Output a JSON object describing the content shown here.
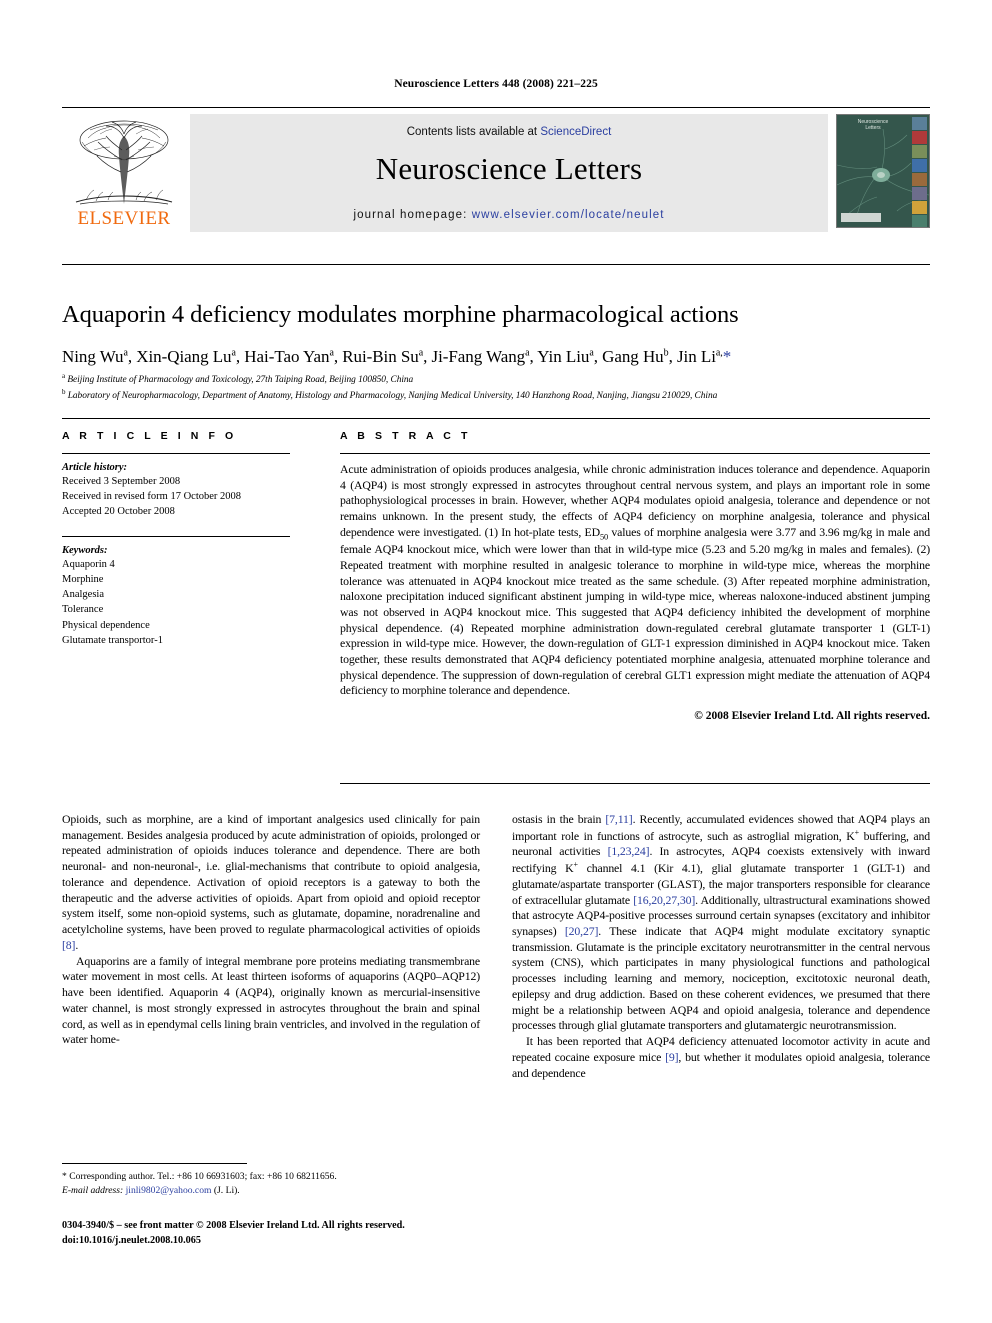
{
  "running_head": "Neuroscience Letters 448 (2008) 221–225",
  "masthead": {
    "publisher_logo_text": "ELSEVIER",
    "contents_prefix": "Contents lists available at ",
    "contents_link": "ScienceDirect",
    "journal_title": "Neuroscience Letters",
    "homepage_prefix": "journal homepage: ",
    "homepage_url": "www.elsevier.com/locate/neulet",
    "cover_title": "Neuroscience Letters"
  },
  "article": {
    "title": "Aquaporin 4 deficiency modulates morphine pharmacological actions",
    "authors_html": "Ning Wu<sup>a</sup>, Xin-Qiang Lu<sup>a</sup>, Hai-Tao Yan<sup>a</sup>, Rui-Bin Su<sup>a</sup>, Ji-Fang Wang<sup>a</sup>, Yin Liu<sup>a</sup>, Gang Hu<sup>b</sup>, Jin Li<sup>a,</sup><span class=\"star\">*</span>",
    "affiliation_a": "Beijing Institute of Pharmacology and Toxicology, 27th Taiping Road, Beijing 100850, China",
    "affiliation_b": "Laboratory of Neuropharmacology, Department of Anatomy, Histology and Pharmacology, Nanjing Medical University, 140 Hanzhong Road, Nanjing, Jiangsu 210029, China"
  },
  "article_info": {
    "heading": "A R T I C L E   I N F O",
    "history_label": "Article history:",
    "history": [
      "Received 3 September 2008",
      "Received in revised form 17 October 2008",
      "Accepted 20 October 2008"
    ],
    "keywords_label": "Keywords:",
    "keywords": [
      "Aquaporin 4",
      "Morphine",
      "Analgesia",
      "Tolerance",
      "Physical dependence",
      "Glutamate transportor-1"
    ]
  },
  "abstract": {
    "heading": "A B S T R A C T",
    "text_html": "Acute administration of opioids produces analgesia, while chronic administration induces tolerance and dependence. Aquaporin 4 (AQP4) is most strongly expressed in astrocytes throughout central nervous system, and plays an important role in some pathophysiological processes in brain. However, whether AQP4 modulates opioid analgesia, tolerance and dependence or not remains unknown. In the present study, the effects of AQP4 deficiency on morphine analgesia, tolerance and physical dependence were investigated. (1) In hot-plate tests, ED<sub>50</sub> values of morphine analgesia were 3.77 and 3.96 mg/kg in male and female AQP4 knockout mice, which were lower than that in wild-type mice (5.23 and 5.20 mg/kg in males and females). (2) Repeated treatment with morphine resulted in analgesic tolerance to morphine in wild-type mice, whereas the morphine tolerance was attenuated in AQP4 knockout mice treated as the same schedule. (3) After repeated morphine administration, naloxone precipitation induced significant abstinent jumping in wild-type mice, whereas naloxone-induced abstinent jumping was not observed in AQP4 knockout mice. This suggested that AQP4 deficiency inhibited the development of morphine physical dependence. (4) Repeated morphine administration down-regulated cerebral glutamate transporter 1 (GLT-1) expression in wild-type mice. However, the down-regulation of GLT-1 expression diminished in AQP4 knockout mice. Taken together, these results demonstrated that AQP4 deficiency potentiated morphine analgesia, attenuated morphine tolerance and physical dependence. The suppression of down-regulation of cerebral GLT1 expression might mediate the attenuation of AQP4 deficiency to morphine tolerance and dependence.",
    "copyright": "© 2008 Elsevier Ireland Ltd. All rights reserved."
  },
  "body": {
    "left_paragraphs_html": [
      "Opioids, such as morphine, are a kind of important analgesics used clinically for pain management. Besides analgesia produced by acute administration of opioids, prolonged or repeated administration of opioids induces tolerance and dependence. There are both neuronal- and non-neuronal-, i.e. glial-mechanisms that contribute to opioid analgesia, tolerance and dependence. Activation of opioid receptors is a gateway to both the therapeutic and the adverse activities of opioids. Apart from opioid and opioid receptor system itself, some non-opioid systems, such as glutamate, dopamine, noradrenaline and acetylcholine systems, have been proved to regulate pharmacological activities of opioids <span class=\"ref\">[8]</span>.",
      "Aquaporins are a family of integral membrane pore proteins mediating transmembrane water movement in most cells. At least thirteen isoforms of aquaporins (AQP0–AQP12) have been identified. Aquaporin 4 (AQP4), originally known as mercurial-insensitive water channel, is most strongly expressed in astrocytes throughout the brain and spinal cord, as well as in ependymal cells lining brain ventricles, and involved in the regulation of water home-"
    ],
    "right_paragraphs_html": [
      "ostasis in the brain <span class=\"ref\">[7,11]</span>. Recently, accumulated evidences showed that AQP4 plays an important role in functions of astrocyte, such as astroglial migration, K<sup class=\"plain\">+</sup> buffering, and neuronal activities <span class=\"ref\">[1,23,24]</span>. In astrocytes, AQP4 coexists extensively with inward rectifying K<sup class=\"plain\">+</sup> channel 4.1 (Kir 4.1), glial glutamate transporter 1 (GLT-1) and glutamate/aspartate transporter (GLAST), the major transporters responsible for clearance of extracellular glutamate <span class=\"ref\">[16,20,27,30]</span>. Additionally, ultrastructural examinations showed that astrocyte AQP4-positive processes surround certain synapses (excitatory and inhibitor synapses) <span class=\"ref\">[20,27]</span>. These indicate that AQP4 might modulate excitatory synaptic transmission. Glutamate is the principle excitatory neurotransmitter in the central nervous system (CNS), which participates in many physiological functions and pathological processes including learning and memory, nociception, excitotoxic neuronal death, epilepsy and drug addiction. Based on these coherent evidences, we presumed that there might be a relationship between AQP4 and opioid analgesia, tolerance and dependence processes through glial glutamate transporters and glutamatergic neurotransmission.",
      "It has been reported that AQP4 deficiency attenuated locomotor activity in acute and repeated cocaine exposure mice <span class=\"ref\">[9]</span>, but whether it modulates opioid analgesia, tolerance and dependence"
    ]
  },
  "footnotes": {
    "corresponding": "* Corresponding author. Tel.: +86 10 66931603; fax: +86 10 68211656.",
    "email_label": "E-mail address:",
    "email_address": "jinli9802@yahoo.com",
    "email_suffix": "(J. Li).",
    "issn_line": "0304-3940/$ – see front matter © 2008 Elsevier Ireland Ltd. All rights reserved.",
    "doi_line": "doi:10.1016/j.neulet.2008.10.065"
  },
  "colors": {
    "link": "#2B3FA0",
    "elsevier_orange": "#F06A0F",
    "band_gray": "#e8e8e8"
  }
}
